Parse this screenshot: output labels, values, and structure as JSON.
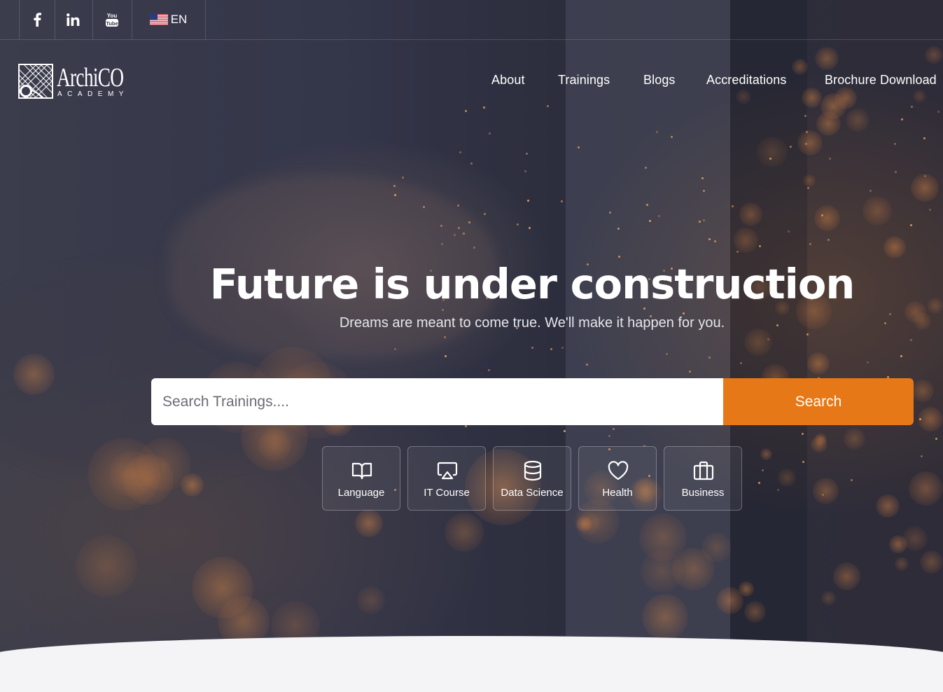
{
  "topbar": {
    "social": [
      {
        "name": "facebook",
        "icon": "facebook-icon",
        "glyph": "f"
      },
      {
        "name": "linkedin",
        "icon": "linkedin-icon",
        "glyph": "in"
      },
      {
        "name": "youtube",
        "icon": "youtube-icon",
        "glyph": "You Tube"
      }
    ],
    "language": {
      "label": "EN",
      "icon": "us-flag-icon"
    }
  },
  "header": {
    "logo": {
      "name": "ArchiCO",
      "sub": "ACADEMY"
    },
    "nav": [
      "About",
      "Trainings",
      "Blogs",
      "Accreditations",
      "Brochure Download"
    ]
  },
  "hero": {
    "title": "Future is under construction",
    "subtitle": "Dreams are meant to come true. We'll make it happen for you."
  },
  "search": {
    "placeholder": "Search Trainings....",
    "value": "",
    "button_label": "Search"
  },
  "categories": [
    {
      "label": "Language",
      "icon": "book-open-icon"
    },
    {
      "label": "IT Course",
      "icon": "airplay-icon"
    },
    {
      "label": "Data Science",
      "icon": "database-icon"
    },
    {
      "label": "Health",
      "icon": "heart-icon"
    },
    {
      "label": "Business",
      "icon": "briefcase-icon"
    }
  ],
  "colors": {
    "accent": "#e77817",
    "text": "#ffffff",
    "overlay": "#2c2e3d"
  }
}
